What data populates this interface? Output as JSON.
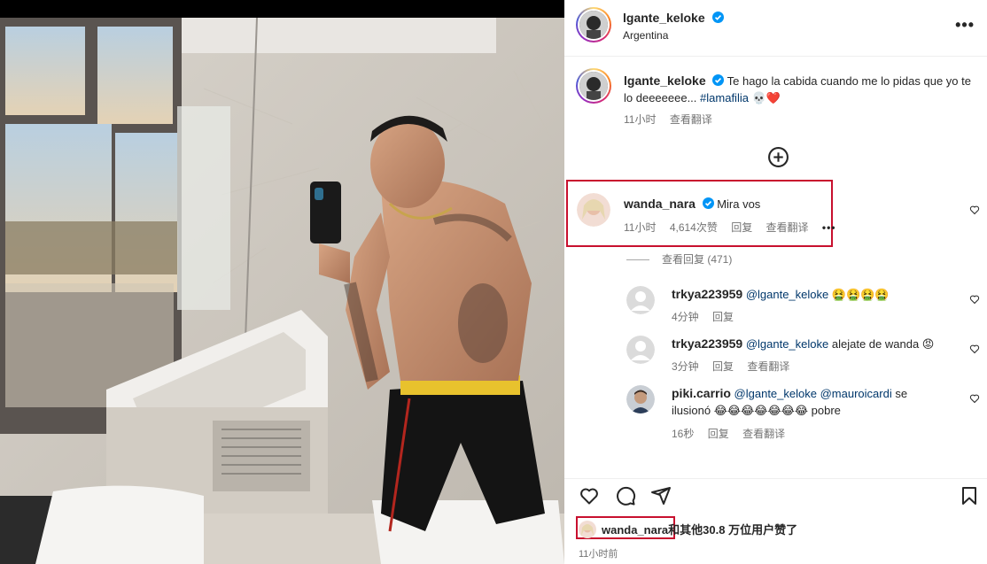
{
  "post_owner": {
    "username": "lgante_keloke",
    "location": "Argentina",
    "verified": true
  },
  "header": {
    "more_icon": "more-horizontal-icon"
  },
  "caption": {
    "username": "lgante_keloke",
    "text": "Te hago la cabida cuando me lo pidas que yo te lo deeeeeee...",
    "hashtag": "#lamafilia",
    "emojis": "💀❤️",
    "time": "11小时",
    "translate": "查看翻译"
  },
  "load_more_icon": "plus-circle-icon",
  "highlight_color": "#c8102e",
  "comments": [
    {
      "username": "wanda_nara",
      "verified": true,
      "text": "Mira vos",
      "time": "11小时",
      "likes": "4,614次赞",
      "reply": "回复",
      "translate": "查看翻译",
      "more": "•••"
    }
  ],
  "view_replies": "查看回复 (471)",
  "replies": [
    {
      "username": "trkya223959",
      "mention": "@lgante_keloke",
      "text": "🤮🤮🤮🤮",
      "time": "4分钟",
      "reply": "回复",
      "translate": ""
    },
    {
      "username": "trkya223959",
      "mention": "@lgante_keloke",
      "text": "alejate de wanda 😡",
      "time": "3分钟",
      "reply": "回复",
      "translate": "查看翻译"
    },
    {
      "username": "piki.carrio",
      "mention": "@lgante_keloke",
      "mention2": "@mauroicardi",
      "text_a": "se",
      "text_b": "ilusionó 😂😂😂😂😂😂😂 pobre",
      "time": "16秒",
      "reply": "回复",
      "translate": "查看翻译"
    }
  ],
  "actions": {
    "like": "heart-icon",
    "comment": "comment-icon",
    "share": "share-icon",
    "save": "bookmark-icon"
  },
  "likes": {
    "user": "wanda_nara",
    "rest": "和其他30.8 万位用户赞了"
  },
  "post_time": "11小时前"
}
